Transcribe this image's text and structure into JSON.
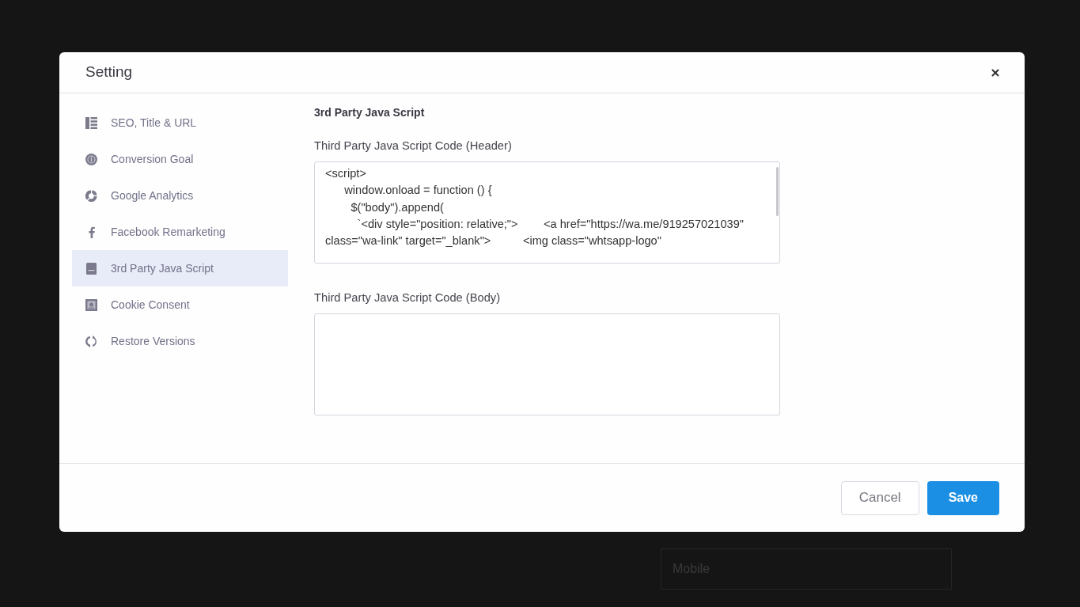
{
  "backdrop": {
    "field": {
      "placeholder": "Mobile"
    }
  },
  "dialog": {
    "title": "Setting"
  },
  "sidebar": {
    "items": [
      {
        "label": "SEO, Title & URL",
        "selected": false
      },
      {
        "label": "Conversion Goal",
        "selected": false
      },
      {
        "label": "Google Analytics",
        "selected": false
      },
      {
        "label": "Facebook Remarketing",
        "selected": false
      },
      {
        "label": "3rd Party Java Script",
        "selected": true
      },
      {
        "label": "Cookie Consent",
        "selected": false
      },
      {
        "label": "Restore Versions",
        "selected": false
      }
    ]
  },
  "content": {
    "heading": "3rd Party Java Script",
    "fields": [
      {
        "label": "Third Party Java Script Code (Header)",
        "value_lines": [
          "<script>",
          "      window.onload = function () {",
          "        $(\"body\").append(",
          "          `<div style=\"position: relative;\">        <a href=\"https://wa.me/919257021039\"",
          "class=\"wa-link\" target=\"_blank\">          <img class=\"whtsapp-logo\""
        ]
      },
      {
        "label": "Third Party Java Script Code (Body)"
      }
    ]
  },
  "footer": {
    "buttons": [
      {
        "kind": "secondary",
        "label": "Cancel"
      },
      {
        "kind": "primary",
        "label": "Save"
      }
    ]
  }
}
